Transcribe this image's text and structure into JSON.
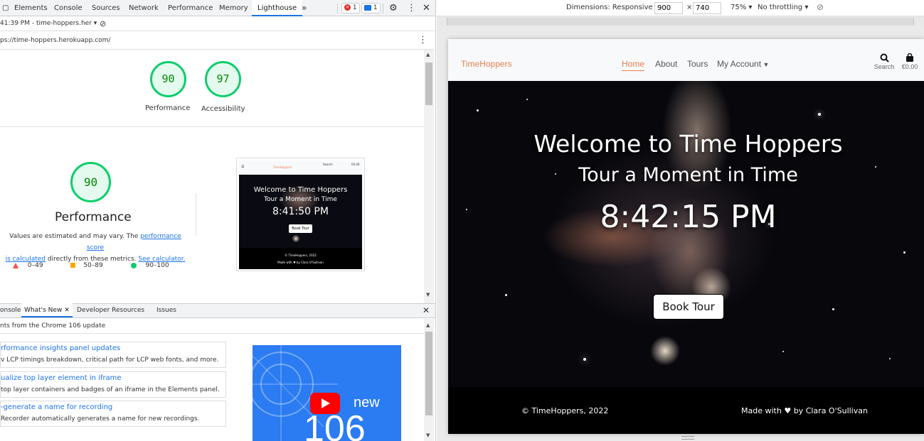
{
  "devtools": {
    "tabs": [
      "Elements",
      "Console",
      "Sources",
      "Network",
      "Performance",
      "Memory",
      "Lighthouse"
    ],
    "more_tabs": "»",
    "errors_count": "1",
    "messages_count": "1",
    "report_select": "41:39 PM - time-hoppers.her",
    "report_url": "ps://time-hoppers.herokuapp.com/",
    "summary_scores": [
      {
        "value": "90",
        "label": "Performance"
      },
      {
        "value": "97",
        "label": "Accessibility"
      }
    ],
    "performance": {
      "score": "90",
      "title": "Performance",
      "note_prefix": "Values are estimated and may vary. The ",
      "note_link1": "performance score",
      "note_link1b": "is calculated",
      "note_mid": " directly from these metrics. ",
      "note_link2": "See calculator.",
      "legend": [
        "0–49",
        "50–89",
        "90–100"
      ],
      "colors": {
        "fail": "#ff4e42",
        "average": "#ffa400",
        "pass": "#0cce6b"
      }
    },
    "thumbnail": {
      "brand": "TimeHoppers",
      "title": "Welcome to Time Hoppers",
      "subtitle": "Tour a Moment in Time",
      "time": "8:41:50 PM",
      "button": "Book Tour",
      "footer1": "© TimeHoppers, 2022",
      "footer2": "Made with ♥ by Clara O'Sullivan",
      "search": "Search",
      "bag": "€0.00"
    },
    "drawer": {
      "tabs": [
        "onsole",
        "What's New",
        "Developer Resources",
        "Issues"
      ],
      "heading": "nts from the Chrome 106 update",
      "items": [
        {
          "title": "rformance insights panel updates",
          "desc": "v LCP timings breakdown, critical path for LCP web fonts, and more."
        },
        {
          "title": "ualize top layer element in iframe",
          "desc": "top layer containers and badges of an iframe in the Elements panel."
        },
        {
          "title": "-generate a name for recording",
          "desc": "Recorder automatically generates a name for new recordings."
        }
      ],
      "video_badge": "new",
      "video_number": "106"
    }
  },
  "device_toolbar": {
    "dimensions": "Dimensions: Responsive",
    "width": "900",
    "times": "×",
    "height": "740",
    "zoom": "75%",
    "throttling": "No throttling"
  },
  "site": {
    "brand": "TimeHoppers",
    "nav": [
      "Home",
      "About",
      "Tours",
      "My Account"
    ],
    "search_label": "Search",
    "bag_total": "€0.00",
    "hero_title": "Welcome to Time Hoppers",
    "hero_subtitle": "Tour a Moment in Time",
    "clock": "8:42:15 PM",
    "cta": "Book Tour",
    "footer_left": "© TimeHoppers, 2022",
    "footer_right_prefix": "Made with",
    "footer_right_suffix": "by Clara O'Sullivan",
    "accent_color": "#e8804f"
  }
}
